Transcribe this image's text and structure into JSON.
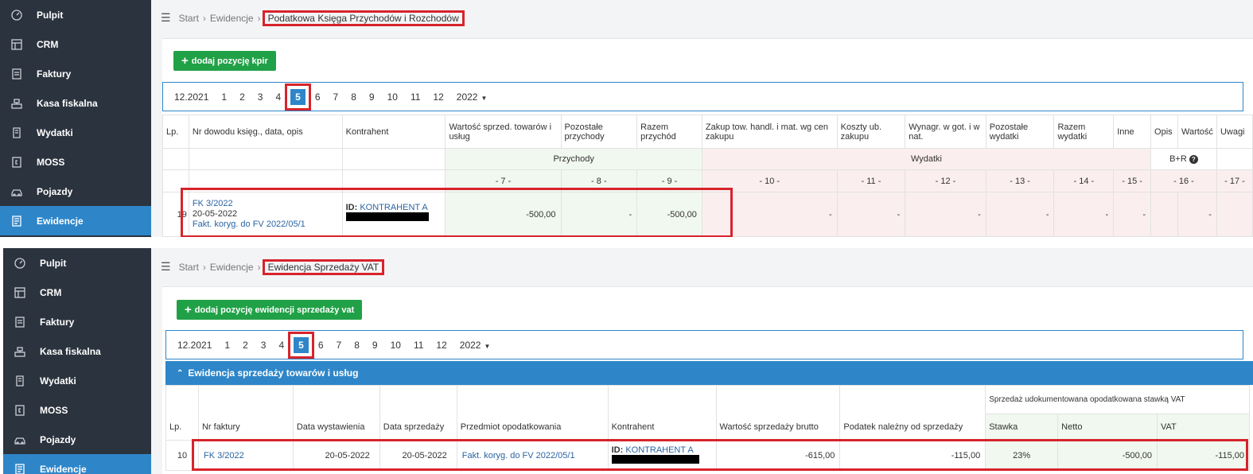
{
  "sidebar": {
    "items": [
      {
        "label": "Pulpit",
        "icon": "dashboard-icon"
      },
      {
        "label": "CRM",
        "icon": "crm-icon"
      },
      {
        "label": "Faktury",
        "icon": "invoice-icon"
      },
      {
        "label": "Kasa fiskalna",
        "icon": "cash-register-icon"
      },
      {
        "label": "Wydatki",
        "icon": "expenses-icon"
      },
      {
        "label": "MOSS",
        "icon": "moss-icon"
      },
      {
        "label": "Pojazdy",
        "icon": "car-icon"
      },
      {
        "label": "Ewidencje",
        "icon": "records-icon"
      }
    ]
  },
  "colors": {
    "accent": "#2e86c9",
    "sidebar": "#2b333e",
    "add_button": "#21a147",
    "highlight": "#d7232b"
  },
  "top": {
    "breadcrumb": {
      "start": "Start",
      "section": "Ewidencje",
      "current": "Podatkowa Księga Przychodów i Rozchodów"
    },
    "add_button": "dodaj pozycję kpir",
    "pager": {
      "prev": "12.2021",
      "months": [
        "1",
        "2",
        "3",
        "4",
        "5",
        "6",
        "7",
        "8",
        "9",
        "10",
        "11",
        "12"
      ],
      "active": "5",
      "year": "2022"
    },
    "headers": {
      "lp": "Lp.",
      "nr": "Nr dowodu księg., data, opis",
      "kontrahent": "Kontrahent",
      "wartosc": "Wartość sprzed. towarów i usług",
      "pozostale_przychody": "Pozostałe przychody",
      "razem_przychod": "Razem przychód",
      "zakup": "Zakup tow. handl. i mat. wg cen zakupu",
      "koszty": "Koszty ub. zakupu",
      "wynagr": "Wynagr. w got. i w nat.",
      "pozostale_wydatki": "Pozostałe wydatki",
      "razem_wydatki": "Razem wydatki",
      "inne": "Inne",
      "opis": "Opis",
      "wartosc2": "Wartość",
      "uwagi": "Uwagi"
    },
    "groups": {
      "przychody": "Przychody",
      "wydatki": "Wydatki",
      "br": "B+R"
    },
    "col_numbers": [
      "- 7 -",
      "- 8 -",
      "- 9 -",
      "- 10 -",
      "- 11 -",
      "- 12 -",
      "- 13 -",
      "- 14 -",
      "- 15 -",
      "- 16 -",
      "- 17 -"
    ],
    "row": {
      "lp": "19",
      "doc": "FK 3/2022",
      "date": "20-05-2022",
      "desc": "Fakt. koryg. do FV 2022/05/1",
      "kontrahent_prefix": "ID:",
      "kontrahent": "KONTRAHENT A",
      "wartosc": "-500,00",
      "pozostale": "-",
      "razem": "-500,00",
      "dash": "-"
    }
  },
  "bottom": {
    "breadcrumb": {
      "start": "Start",
      "section": "Ewidencje",
      "current": "Ewidencja Sprzedaży VAT"
    },
    "add_button": "dodaj pozycję ewidencji sprzedaży vat",
    "pager": {
      "prev": "12.2021",
      "months": [
        "1",
        "2",
        "3",
        "4",
        "5",
        "6",
        "7",
        "8",
        "9",
        "10",
        "11",
        "12"
      ],
      "active": "5",
      "year": "2022"
    },
    "section_title": "Ewidencja sprzedaży towarów i usług",
    "group_header": "Sprzedaż udokumentowana opodatkowana stawką VAT",
    "headers": {
      "lp": "Lp.",
      "nr": "Nr faktury",
      "data_wyst": "Data wystawienia",
      "data_sprz": "Data sprzedaży",
      "przedmiot": "Przedmiot opodatkowania",
      "kontrahent": "Kontrahent",
      "brutto": "Wartość sprzedaży brutto",
      "podatek": "Podatek należny od sprzedaży",
      "stawka": "Stawka",
      "netto": "Netto",
      "vat": "VAT"
    },
    "row": {
      "lp": "10",
      "nr": "FK 3/2022",
      "data_wyst": "20-05-2022",
      "data_sprz": "20-05-2022",
      "przedmiot": "Fakt. koryg. do FV 2022/05/1",
      "kontrahent_prefix": "ID:",
      "kontrahent": "KONTRAHENT A",
      "brutto": "-615,00",
      "podatek": "-115,00",
      "stawka": "23%",
      "netto": "-500,00",
      "vat": "-115,00"
    }
  }
}
